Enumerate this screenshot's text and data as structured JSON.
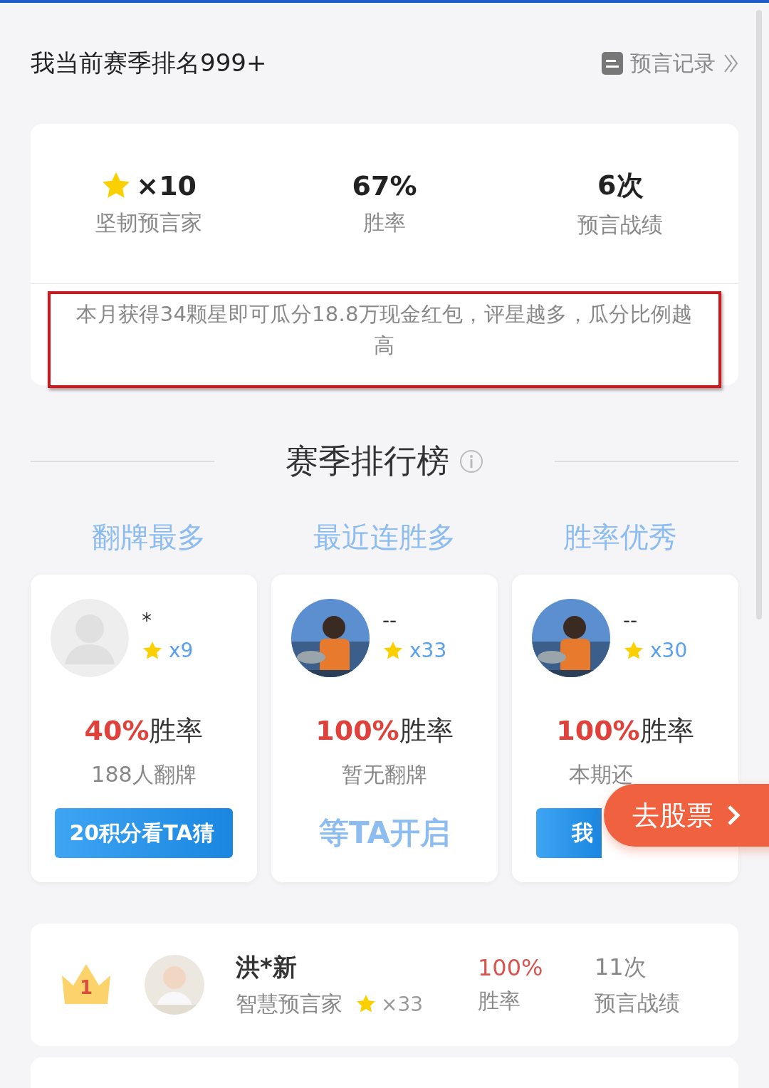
{
  "header": {
    "title": "我当前赛季排名999+",
    "link": "预言记录"
  },
  "stats": [
    {
      "kind": "stars",
      "value": "×10",
      "label": "坚韧预言家"
    },
    {
      "kind": "text",
      "value": "67%",
      "label": "胜率"
    },
    {
      "kind": "text",
      "value": "6次",
      "label": "预言战绩"
    }
  ],
  "notice": "本月获得34颗星即可瓜分18.8万现金红包，评星越多，瓜分比例越高",
  "leaderboard": {
    "title": "赛季排行榜",
    "tabs": [
      {
        "label": "翻牌最多",
        "selected": false
      },
      {
        "label": "最近连胜多",
        "selected": false
      },
      {
        "label": "胜率优秀",
        "selected": false
      }
    ],
    "cards": [
      {
        "avatar": {
          "kind": "placeholder"
        },
        "name": "*",
        "stars": "x9",
        "rate": "40%",
        "rate_label": "胜率",
        "sub": "188人翻牌",
        "action": {
          "kind": "button",
          "label": "20积分看TA猜"
        }
      },
      {
        "name": "--",
        "stars": "x33",
        "rate": "100%",
        "rate_label": "胜率",
        "sub": "暂无翻牌",
        "action": {
          "kind": "waiting",
          "label": "等TA开启"
        }
      },
      {
        "name": "--",
        "stars": "x30",
        "rate": "100%",
        "rate_label": "胜率",
        "sub": "本期还",
        "action": {
          "kind": "button",
          "label": "我"
        }
      }
    ],
    "rows": [
      {
        "rank": "1",
        "name": "洪*新",
        "title": "智慧预言家",
        "stars": "×33",
        "rate": "100%",
        "rate_label": "胜率",
        "count": "11次",
        "count_label": "预言战绩"
      }
    ]
  },
  "float_button": {
    "label": "去股票"
  }
}
